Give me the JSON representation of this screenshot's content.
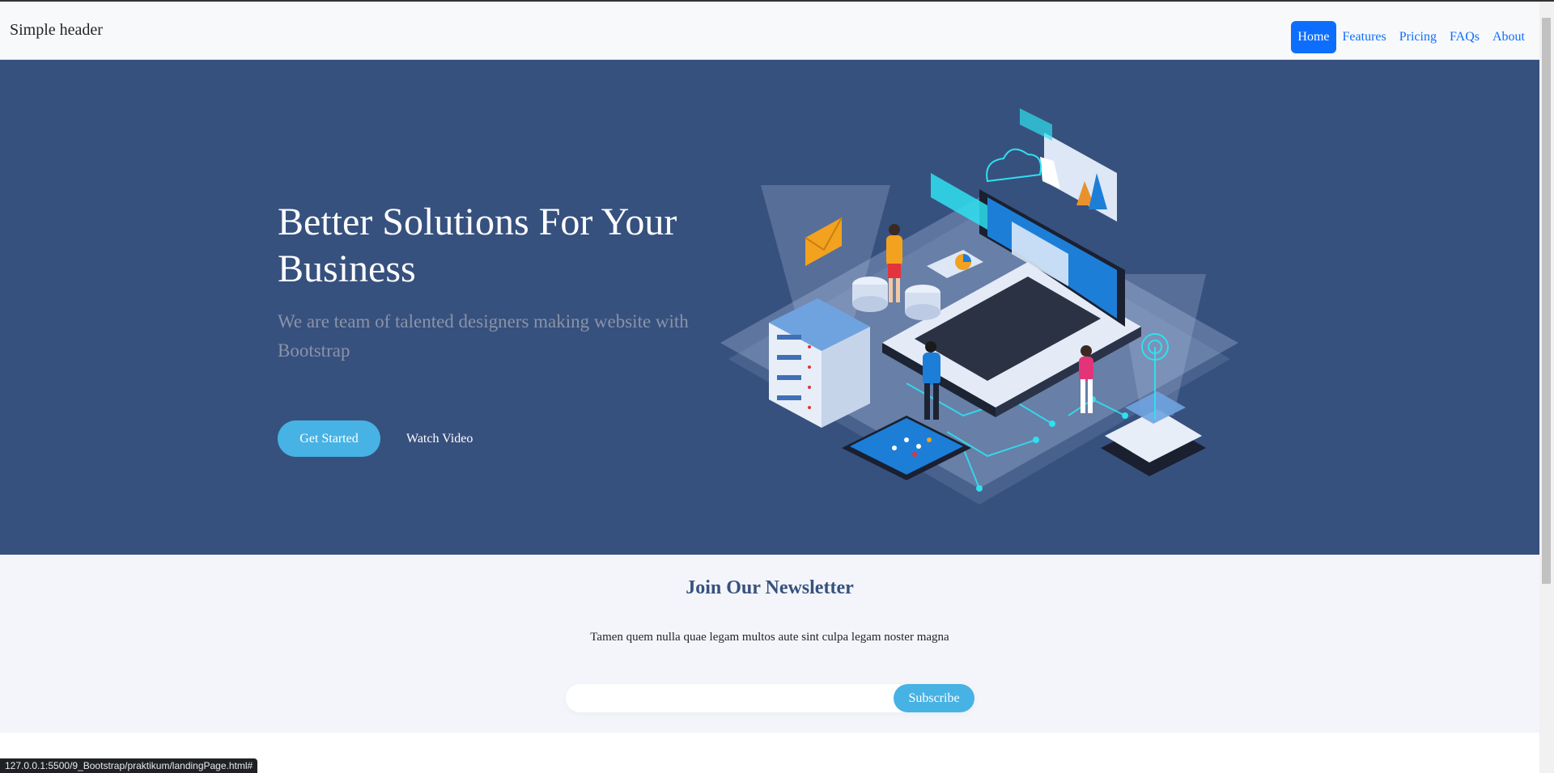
{
  "header": {
    "brand": "Simple header",
    "nav": [
      {
        "label": "Home",
        "active": true
      },
      {
        "label": "Features",
        "active": false
      },
      {
        "label": "Pricing",
        "active": false
      },
      {
        "label": "FAQs",
        "active": false
      },
      {
        "label": "About",
        "active": false
      }
    ]
  },
  "hero": {
    "title": "Better Solutions For Your Business",
    "subtitle": "We are team of talented designers making website with Bootstrap",
    "primary_button": "Get Started",
    "secondary_button": "Watch Video",
    "illustration": "isometric-laptop-servers-illustration"
  },
  "newsletter": {
    "title": "Join Our Newsletter",
    "text": "Tamen quem nulla quae legam multos aute sint culpa legam noster magna",
    "input_value": "",
    "submit_label": "Subscribe"
  },
  "status_bar": {
    "url": "127.0.0.1:5500/9_Bootstrap/praktikum/landingPage.html#"
  },
  "colors": {
    "hero_bg": "#37517e",
    "accent": "#47b2e4",
    "nav_active": "#0d6efd",
    "newsletter_bg": "#f3f5fa"
  }
}
